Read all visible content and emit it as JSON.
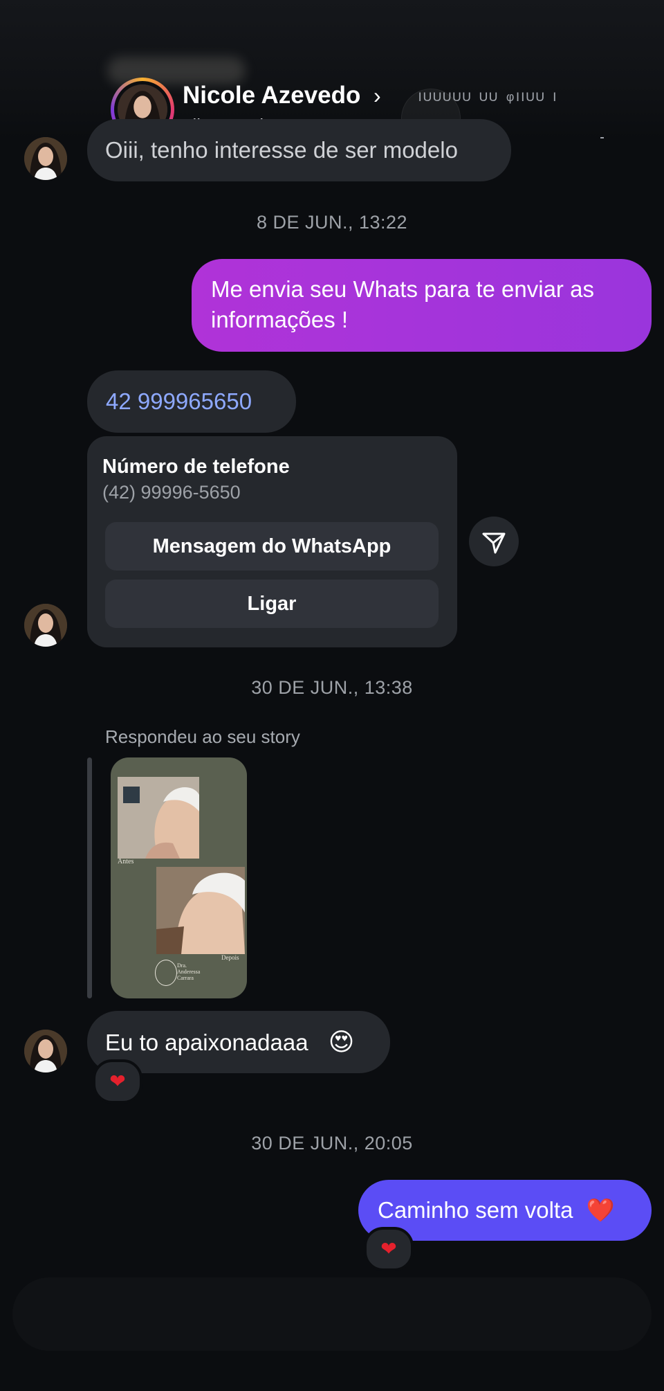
{
  "header": {
    "name": "Nicole Azevedo",
    "chevron": "›",
    "username": "nii.azevedo",
    "obscured_text": "ᴵᵁᵁᵁᵁᵁ ᵁᵁ ᵠᴵᴵᵁᵁ ᴵ"
  },
  "messages": {
    "first_in": "Oiii, tenho interesse de ser modelo",
    "ts1": "8 DE JUN., 13:22",
    "out1_line1": "Me envia seu Whats para te enviar as",
    "out1_line2": "informações !",
    "phone_in": "42 999965650",
    "card": {
      "title": "Número de telefone",
      "subtitle": "(42) 99996-5650",
      "btn_whatsapp": "Mensagem do WhatsApp",
      "btn_call": "Ligar"
    },
    "ts2": "30 DE JUN., 13:38",
    "replied_label": "Respondeu ao seu story",
    "story": {
      "antes": "Antes",
      "depois": "Depois",
      "brand_line1": "Dra.",
      "brand_line2": "Anderessa",
      "brand_line3": "Carrara"
    },
    "in2": "Eu to apaixonadaaa",
    "in2_emoji": "😍",
    "reaction_heart": "❤",
    "ts3": "30 DE JUN., 20:05",
    "out2": "Caminho sem volta",
    "out2_emoji": "❤️"
  },
  "colors": {
    "background": "#0b0d10",
    "incoming_bubble": "#25282d",
    "outgoing_purple": "#a832d8",
    "outgoing_indigo": "#5b4df5",
    "link_blue": "#8ea9ff"
  },
  "icons": {
    "share": "paper-plane-icon",
    "back": "chevron-right-icon",
    "reaction": "heart-icon"
  }
}
